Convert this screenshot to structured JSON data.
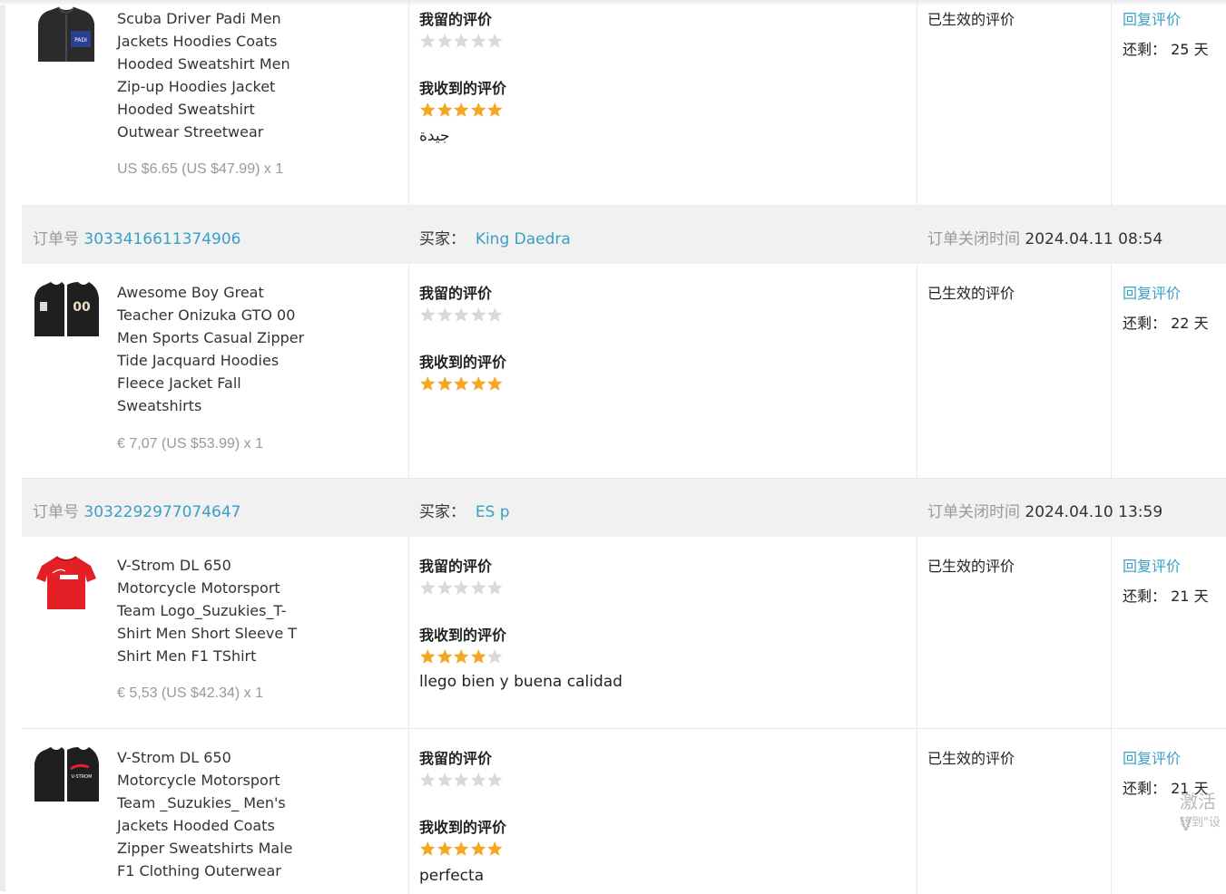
{
  "labels": {
    "my_review": "我留的评价",
    "received_review": "我收到的评价",
    "effective": "已生效的评价",
    "reply": "回复评价",
    "remaining_prefix": "还剩：",
    "days_suffix": "天",
    "order_prefix": "订单号",
    "buyer_prefix": "买家：",
    "closed_prefix": "订单关闭时间"
  },
  "colors": {
    "star_filled": "#f5a623",
    "star_empty": "#d9d9d9",
    "link": "#3a9fc4",
    "header_bg": "#f1f1f1"
  },
  "items": [
    {
      "title": "Scuba Driver Padi Men Jackets Hoodies Coats Hooded Sweatshirt Men Zip-up Hoodies Jacket Hooded Sweatshirt Outwear Streetwear",
      "price": "US $6.65 (US $47.99) x 1",
      "thumb": "dark-hoodie-padi",
      "my_rating": 0,
      "received_rating": 5,
      "comment": "جيدة",
      "remaining_days": "25"
    },
    {
      "title": "Awesome Boy Great Teacher Onizuka GTO 00 Men Sports Casual Zipper Tide Jacquard Hoodies Fleece Jacket Fall Sweatshirts",
      "price": "€ 7,07 (US $53.99) x 1",
      "thumb": "dark-hoodie-gto",
      "my_rating": 0,
      "received_rating": 5,
      "comment": "",
      "remaining_days": "22"
    },
    {
      "title": "V-Strom DL 650 Motorcycle Motorsport Team Logo_Suzukies_T-Shirt Men Short Sleeve T Shirt Men F1 TShirt",
      "price": "€ 5,53 (US $42.34) x 1",
      "thumb": "red-tshirt",
      "my_rating": 0,
      "received_rating": 4,
      "comment": "llego bien y buena calidad",
      "remaining_days": "21"
    },
    {
      "title": "V-Strom DL 650 Motorcycle Motorsport Team _Suzukies_ Men's Jackets Hooded Coats Zipper Sweatshirts Male F1 Clothing Outerwear",
      "price": "",
      "thumb": "dark-hoodie-vstrom",
      "my_rating": 0,
      "received_rating": 5,
      "comment": "perfecta",
      "remaining_days": "21"
    }
  ],
  "orders": [
    {
      "order_no": "3033416611374906",
      "buyer": "King Daedra",
      "closed_time": "2024.04.11 08:54"
    },
    {
      "order_no": "3032292977074647",
      "buyer": "ES p",
      "closed_time": "2024.04.10 13:59"
    }
  ],
  "watermark": {
    "line1": "激活 V",
    "line2": "转到\"设"
  }
}
